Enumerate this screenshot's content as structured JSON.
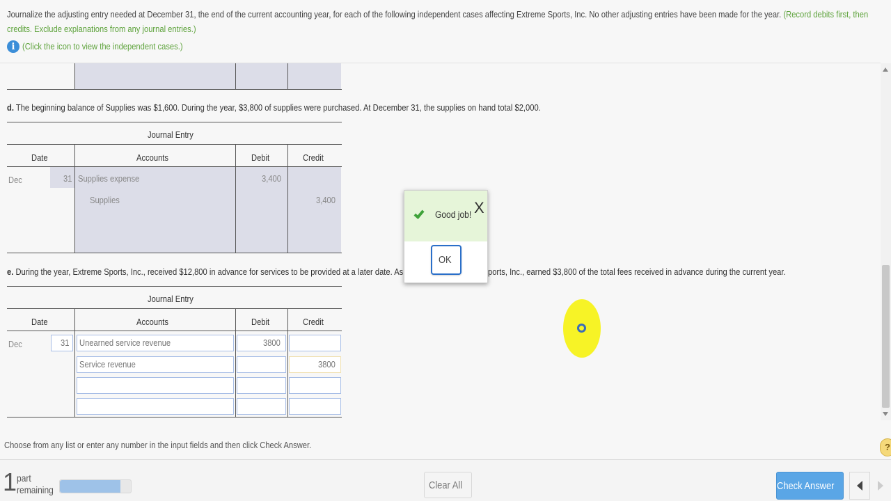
{
  "instructions": {
    "main": "Journalize the adjusting entry needed at December 31, the end of the current accounting year, for each of the following independent cases affecting Extreme Sports, Inc. No other adjusting entries have been made for the year.",
    "note": "(Record debits first, then credits. Exclude explanations from any journal entries.)",
    "info_link": "(Click the icon to view the independent cases.)"
  },
  "case_d": {
    "label": "d.",
    "text": "The beginning balance of Supplies was $1,600. During the year, $3,800 of supplies were purchased. At December 31, the supplies on hand total $2,000.",
    "table_title": "Journal Entry",
    "headers": {
      "date": "Date",
      "accounts": "Accounts",
      "debit": "Debit",
      "credit": "Credit"
    },
    "month": "Dec",
    "day": "31",
    "rows": [
      {
        "account": "Supplies expense",
        "debit": "3,400",
        "credit": ""
      },
      {
        "account": "Supplies",
        "debit": "",
        "credit": "3,400"
      }
    ]
  },
  "case_e": {
    "label": "e.",
    "text_left": "During the year, Extreme Sports, Inc., received $12,800 in advance for services to be provided at a later date. As of",
    "text_right": "ports, Inc., earned $3,800 of the total fees received in advance during the current year.",
    "table_title": "Journal Entry",
    "headers": {
      "date": "Date",
      "accounts": "Accounts",
      "debit": "Debit",
      "credit": "Credit"
    },
    "month": "Dec",
    "day": "31",
    "rows": [
      {
        "account": "Unearned service revenue",
        "debit": "3800",
        "credit": ""
      },
      {
        "account": "Service revenue",
        "debit": "",
        "credit": "3800"
      },
      {
        "account": "",
        "debit": "",
        "credit": ""
      },
      {
        "account": "",
        "debit": "",
        "credit": ""
      }
    ]
  },
  "dialog": {
    "message": "Good job!",
    "close": "X",
    "ok": "OK"
  },
  "footer": {
    "hint": "Choose from any list or enter any number in the input fields and then click Check Answer.",
    "help": "?"
  },
  "bottom_bar": {
    "part_count": "1",
    "part_label_1": "part",
    "part_label_2": "remaining",
    "progress_fraction": 0.85,
    "clear_all": "Clear All",
    "check_answer": "Check Answer"
  },
  "colors": {
    "accent": "#5aa6e6",
    "success_green": "#3fa23a",
    "note_green": "#5ea33c",
    "input_border": "#a7bde6"
  }
}
